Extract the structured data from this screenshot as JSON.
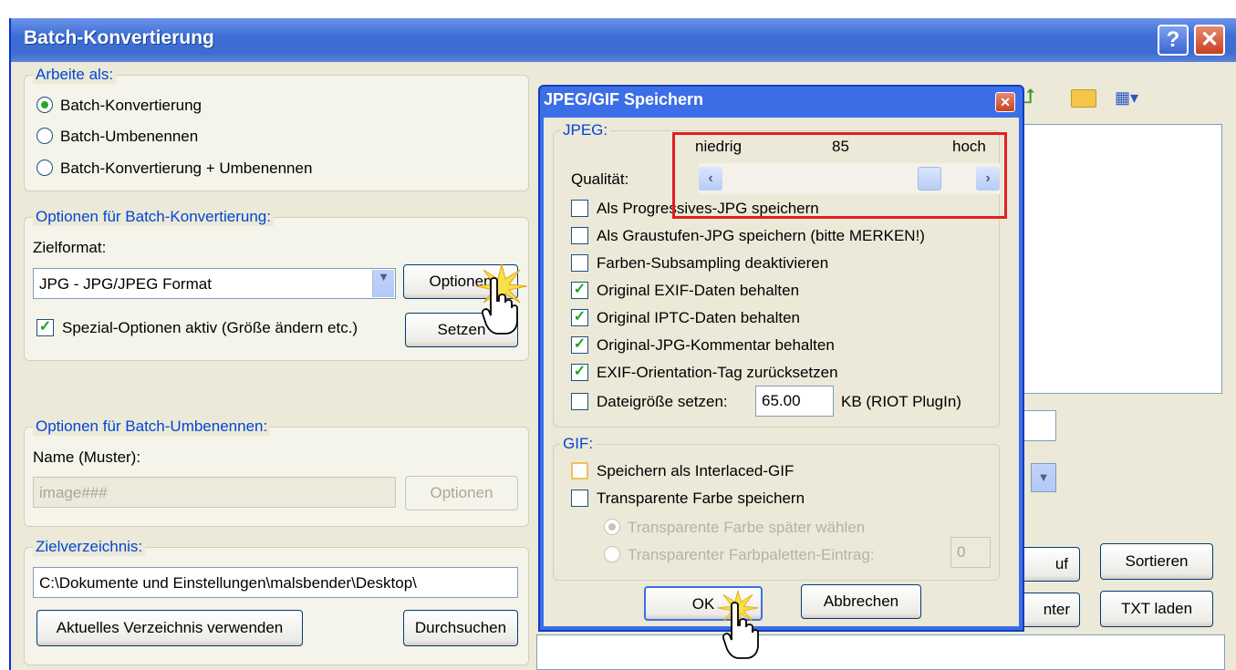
{
  "window": {
    "title": "Batch-Konvertierung",
    "help_label": "?",
    "close_label": "✕"
  },
  "work_as": {
    "label": "Arbeite als:",
    "options": [
      {
        "label": "Batch-Konvertierung",
        "selected": true
      },
      {
        "label": "Batch-Umbenennen",
        "selected": false
      },
      {
        "label": "Batch-Konvertierung + Umbenennen",
        "selected": false
      }
    ]
  },
  "batch_conversion": {
    "label": "Optionen für Batch-Konvertierung:",
    "target_format_label": "Zielformat:",
    "target_format_value": "JPG - JPG/JPEG Format",
    "options_button": "Optionen",
    "special_options_label": "Spezial-Optionen aktiv (Größe ändern etc.)",
    "special_options_checked": true,
    "set_button": "Setzen"
  },
  "batch_rename": {
    "label": "Optionen für Batch-Umbenennen:",
    "name_label": "Name (Muster):",
    "name_value": "image###",
    "options_button": "Optionen"
  },
  "target_dir": {
    "label": "Zielverzeichnis:",
    "path": "C:\\Dokumente und Einstellungen\\malsbender\\Desktop\\",
    "use_current_button": "Aktuelles Verzeichnis verwenden",
    "browse_button": "Durchsuchen"
  },
  "right_buttons": {
    "partial_1": "uf",
    "sort": "Sortieren",
    "partial_2": "nter",
    "load_txt": "TXT laden"
  },
  "dialog": {
    "title": "JPEG/GIF Speichern",
    "close_label": "✕",
    "jpeg": {
      "label": "JPEG:",
      "quality_label": "Qualität:",
      "low_label": "niedrig",
      "high_label": "hoch",
      "quality_value": "85",
      "quality_fraction": 0.85,
      "checkboxes": [
        {
          "label": "Als Progressives-JPG speichern",
          "checked": false
        },
        {
          "label": "Als Graustufen-JPG speichern (bitte MERKEN!)",
          "checked": false
        },
        {
          "label": "Farben-Subsampling deaktivieren",
          "checked": false
        },
        {
          "label": "Original EXIF-Daten behalten",
          "checked": true
        },
        {
          "label": "Original IPTC-Daten behalten",
          "checked": true
        },
        {
          "label": "Original-JPG-Kommentar behalten",
          "checked": true
        },
        {
          "label": "EXIF-Orientation-Tag zurücksetzen",
          "checked": true
        }
      ],
      "filesize_label": "Dateigröße setzen:",
      "filesize_value": "65.00",
      "filesize_unit": "KB (RIOT PlugIn)"
    },
    "gif": {
      "label": "GIF:",
      "interlaced_label": "Speichern als Interlaced-GIF",
      "transparent_label": "Transparente Farbe speichern",
      "choose_later_label": "Transparente Farbe später wählen",
      "palette_entry_label": "Transparenter Farbpaletten-Eintrag:",
      "palette_entry_value": "0"
    },
    "ok_button": "OK",
    "cancel_button": "Abbrechen"
  }
}
